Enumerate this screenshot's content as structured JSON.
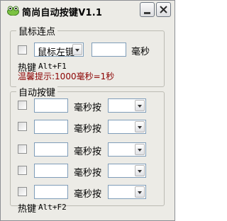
{
  "window": {
    "title": "简尚自动按键V1.1"
  },
  "click_group": {
    "label": "鼠标连点",
    "mouse_button": "鼠标左键",
    "interval_value": "",
    "unit": "毫秒",
    "hotkey_label": "热键",
    "hotkey": "Alt+F1",
    "tip": "温馨提示:1000毫秒=1秒"
  },
  "key_group": {
    "label": "自动按键",
    "rows": [
      {
        "interval": "",
        "label": "毫秒按",
        "key": ""
      },
      {
        "interval": "",
        "label": "毫秒按",
        "key": ""
      },
      {
        "interval": "",
        "label": "毫秒按",
        "key": ""
      },
      {
        "interval": "",
        "label": "毫秒按",
        "key": ""
      },
      {
        "interval": "",
        "label": "毫秒按",
        "key": ""
      }
    ]
  },
  "footer": {
    "hotkey_label": "热键",
    "hotkey": "Alt+F2"
  },
  "colors": {
    "tip": "#8b0000",
    "background": "#ecebe6"
  }
}
